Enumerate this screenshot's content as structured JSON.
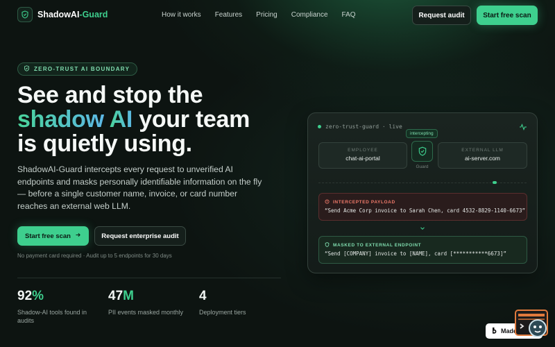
{
  "nav": {
    "brand_main": "ShadowAI",
    "brand_accent": "-Guard",
    "links": [
      "How it works",
      "Features",
      "Pricing",
      "Compliance",
      "FAQ"
    ],
    "request_audit": "Request audit",
    "start_scan": "Start free scan"
  },
  "hero": {
    "badge": "ZERO-TRUST AI BOUNDARY",
    "title_line1": "See and stop the",
    "title_accent1": "shadow",
    "title_accent2": "AI",
    "title_line2_rest": " your team",
    "title_line3": "is quietly using.",
    "lead": "ShadowAI-Guard intercepts every request to unverified AI endpoints and masks personally identifiable information on the fly — before a single customer name, invoice, or card number reaches an external web LLM.",
    "cta_primary": "Start free scan",
    "cta_secondary": "Request enterprise audit",
    "fine_print": "No payment card required · Audit up to 5 endpoints for 30 days"
  },
  "stats": [
    {
      "num": "92",
      "suffix": "%",
      "label": "Shadow-AI tools found in audits"
    },
    {
      "num": "47",
      "suffix": "M",
      "label": "PII events masked monthly"
    },
    {
      "num": "4",
      "suffix": "",
      "label": "Deployment tiers"
    }
  ],
  "panel": {
    "title": "zero-trust-guard · live",
    "employee_title": "EMPLOYEE",
    "employee_value": "chat-ai-portal",
    "guard_tag": "intercepting",
    "guard_label": "Guard",
    "llm_title": "EXTERNAL LLM",
    "llm_value": "ai-server.com",
    "intercepted_label": "INTERCEPTED PAYLOAD",
    "intercepted_text": "“Send Acme Corp invoice to Sarah Chen, card 4532-8829-1140-6673”",
    "masked_label": "MASKED TO EXTERNAL ENDPOINT",
    "masked_text": "“Send [COMPANY] invoice to [NAME], card [***********6673]”"
  },
  "footer_badge": {
    "label": "Made in B"
  },
  "colors": {
    "accent": "#3ecf8e",
    "background": "#0d1411",
    "alert": "#f07a6a"
  }
}
